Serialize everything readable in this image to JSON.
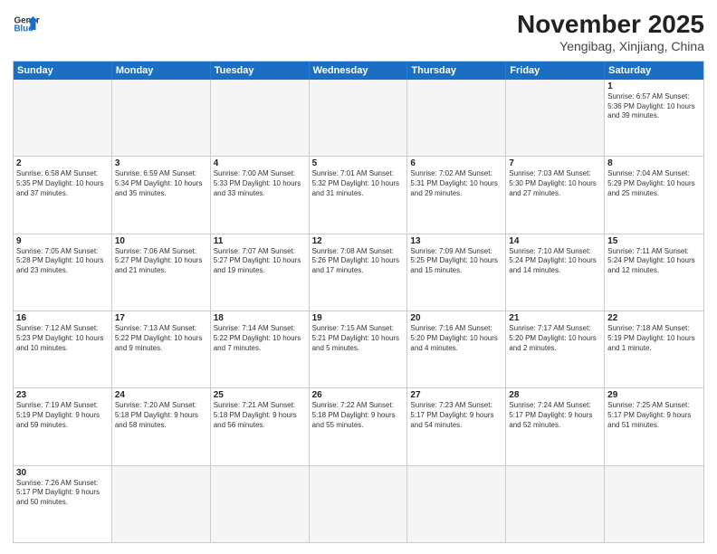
{
  "header": {
    "logo_line1": "General",
    "logo_line2": "Blue",
    "month_title": "November 2025",
    "location": "Yengibag, Xinjiang, China"
  },
  "days_of_week": [
    "Sunday",
    "Monday",
    "Tuesday",
    "Wednesday",
    "Thursday",
    "Friday",
    "Saturday"
  ],
  "weeks": [
    [
      {
        "day": "",
        "info": ""
      },
      {
        "day": "",
        "info": ""
      },
      {
        "day": "",
        "info": ""
      },
      {
        "day": "",
        "info": ""
      },
      {
        "day": "",
        "info": ""
      },
      {
        "day": "",
        "info": ""
      },
      {
        "day": "1",
        "info": "Sunrise: 6:57 AM\nSunset: 5:36 PM\nDaylight: 10 hours and 39 minutes."
      }
    ],
    [
      {
        "day": "2",
        "info": "Sunrise: 6:58 AM\nSunset: 5:35 PM\nDaylight: 10 hours and 37 minutes."
      },
      {
        "day": "3",
        "info": "Sunrise: 6:59 AM\nSunset: 5:34 PM\nDaylight: 10 hours and 35 minutes."
      },
      {
        "day": "4",
        "info": "Sunrise: 7:00 AM\nSunset: 5:33 PM\nDaylight: 10 hours and 33 minutes."
      },
      {
        "day": "5",
        "info": "Sunrise: 7:01 AM\nSunset: 5:32 PM\nDaylight: 10 hours and 31 minutes."
      },
      {
        "day": "6",
        "info": "Sunrise: 7:02 AM\nSunset: 5:31 PM\nDaylight: 10 hours and 29 minutes."
      },
      {
        "day": "7",
        "info": "Sunrise: 7:03 AM\nSunset: 5:30 PM\nDaylight: 10 hours and 27 minutes."
      },
      {
        "day": "8",
        "info": "Sunrise: 7:04 AM\nSunset: 5:29 PM\nDaylight: 10 hours and 25 minutes."
      }
    ],
    [
      {
        "day": "9",
        "info": "Sunrise: 7:05 AM\nSunset: 5:28 PM\nDaylight: 10 hours and 23 minutes."
      },
      {
        "day": "10",
        "info": "Sunrise: 7:06 AM\nSunset: 5:27 PM\nDaylight: 10 hours and 21 minutes."
      },
      {
        "day": "11",
        "info": "Sunrise: 7:07 AM\nSunset: 5:27 PM\nDaylight: 10 hours and 19 minutes."
      },
      {
        "day": "12",
        "info": "Sunrise: 7:08 AM\nSunset: 5:26 PM\nDaylight: 10 hours and 17 minutes."
      },
      {
        "day": "13",
        "info": "Sunrise: 7:09 AM\nSunset: 5:25 PM\nDaylight: 10 hours and 15 minutes."
      },
      {
        "day": "14",
        "info": "Sunrise: 7:10 AM\nSunset: 5:24 PM\nDaylight: 10 hours and 14 minutes."
      },
      {
        "day": "15",
        "info": "Sunrise: 7:11 AM\nSunset: 5:24 PM\nDaylight: 10 hours and 12 minutes."
      }
    ],
    [
      {
        "day": "16",
        "info": "Sunrise: 7:12 AM\nSunset: 5:23 PM\nDaylight: 10 hours and 10 minutes."
      },
      {
        "day": "17",
        "info": "Sunrise: 7:13 AM\nSunset: 5:22 PM\nDaylight: 10 hours and 9 minutes."
      },
      {
        "day": "18",
        "info": "Sunrise: 7:14 AM\nSunset: 5:22 PM\nDaylight: 10 hours and 7 minutes."
      },
      {
        "day": "19",
        "info": "Sunrise: 7:15 AM\nSunset: 5:21 PM\nDaylight: 10 hours and 5 minutes."
      },
      {
        "day": "20",
        "info": "Sunrise: 7:16 AM\nSunset: 5:20 PM\nDaylight: 10 hours and 4 minutes."
      },
      {
        "day": "21",
        "info": "Sunrise: 7:17 AM\nSunset: 5:20 PM\nDaylight: 10 hours and 2 minutes."
      },
      {
        "day": "22",
        "info": "Sunrise: 7:18 AM\nSunset: 5:19 PM\nDaylight: 10 hours and 1 minute."
      }
    ],
    [
      {
        "day": "23",
        "info": "Sunrise: 7:19 AM\nSunset: 5:19 PM\nDaylight: 9 hours and 59 minutes."
      },
      {
        "day": "24",
        "info": "Sunrise: 7:20 AM\nSunset: 5:18 PM\nDaylight: 9 hours and 58 minutes."
      },
      {
        "day": "25",
        "info": "Sunrise: 7:21 AM\nSunset: 5:18 PM\nDaylight: 9 hours and 56 minutes."
      },
      {
        "day": "26",
        "info": "Sunrise: 7:22 AM\nSunset: 5:18 PM\nDaylight: 9 hours and 55 minutes."
      },
      {
        "day": "27",
        "info": "Sunrise: 7:23 AM\nSunset: 5:17 PM\nDaylight: 9 hours and 54 minutes."
      },
      {
        "day": "28",
        "info": "Sunrise: 7:24 AM\nSunset: 5:17 PM\nDaylight: 9 hours and 52 minutes."
      },
      {
        "day": "29",
        "info": "Sunrise: 7:25 AM\nSunset: 5:17 PM\nDaylight: 9 hours and 51 minutes."
      }
    ],
    [
      {
        "day": "30",
        "info": "Sunrise: 7:26 AM\nSunset: 5:17 PM\nDaylight: 9 hours and 50 minutes."
      },
      {
        "day": "",
        "info": ""
      },
      {
        "day": "",
        "info": ""
      },
      {
        "day": "",
        "info": ""
      },
      {
        "day": "",
        "info": ""
      },
      {
        "day": "",
        "info": ""
      },
      {
        "day": "",
        "info": ""
      }
    ]
  ]
}
